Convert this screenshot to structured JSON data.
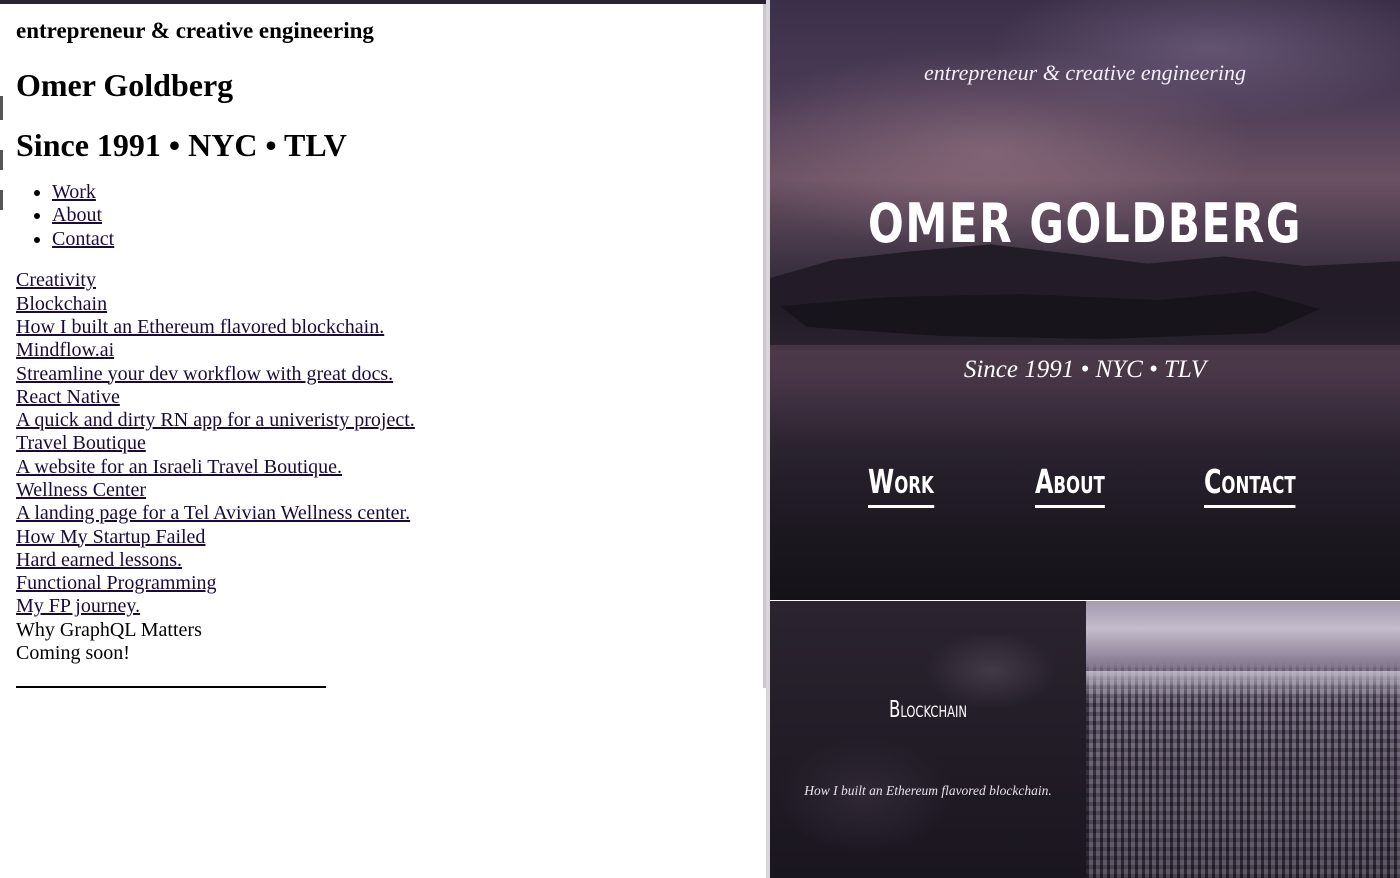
{
  "plain_page": {
    "tagline": "entrepreneur & creative engineering",
    "name": "Omer Goldberg",
    "since": "Since 1991 • NYC • TLV",
    "nav": [
      "Work",
      "About",
      "Contact"
    ],
    "projects": [
      {
        "title": "Creativity",
        "linked": true
      },
      {
        "title": "Blockchain",
        "linked": true
      },
      {
        "title": "How I built an Ethereum flavored blockchain.",
        "linked": true
      },
      {
        "title": "Mindflow.ai",
        "linked": true
      },
      {
        "title": "Streamline your dev workflow with great docs.",
        "linked": true
      },
      {
        "title": "React Native",
        "linked": true
      },
      {
        "title": "A quick and dirty RN app for a univeristy project.",
        "linked": true
      },
      {
        "title": "Travel Boutique",
        "linked": true
      },
      {
        "title": "A website for an Israeli Travel Boutique.",
        "linked": true
      },
      {
        "title": "Wellness Center",
        "linked": true
      },
      {
        "title": "A landing page for a Tel Avivian Wellness center.",
        "linked": true
      },
      {
        "title": "How My Startup Failed",
        "linked": true
      },
      {
        "title": "Hard earned lessons.",
        "linked": true
      },
      {
        "title": "Functional Programming",
        "linked": true
      },
      {
        "title": "My FP journey.",
        "linked": true
      },
      {
        "title": "Why GraphQL Matters",
        "linked": false
      },
      {
        "title": "Coming soon!",
        "linked": false
      }
    ]
  },
  "styled_page": {
    "tagline": "entrepreneur & creative engineering",
    "name": "OMER GOLDBERG",
    "since": "Since 1991 • NYC • TLV",
    "nav": {
      "work": "Work",
      "about": "About",
      "contact": "Contact"
    },
    "tile": {
      "title": "Blockchain",
      "description": "How I built an Ethereum flavored blockchain."
    }
  },
  "colors": {
    "link": "#1a0b3b",
    "hero_dark": "#1b1820",
    "hero_purple": "#4b3b55",
    "text_light": "#ffffff"
  }
}
